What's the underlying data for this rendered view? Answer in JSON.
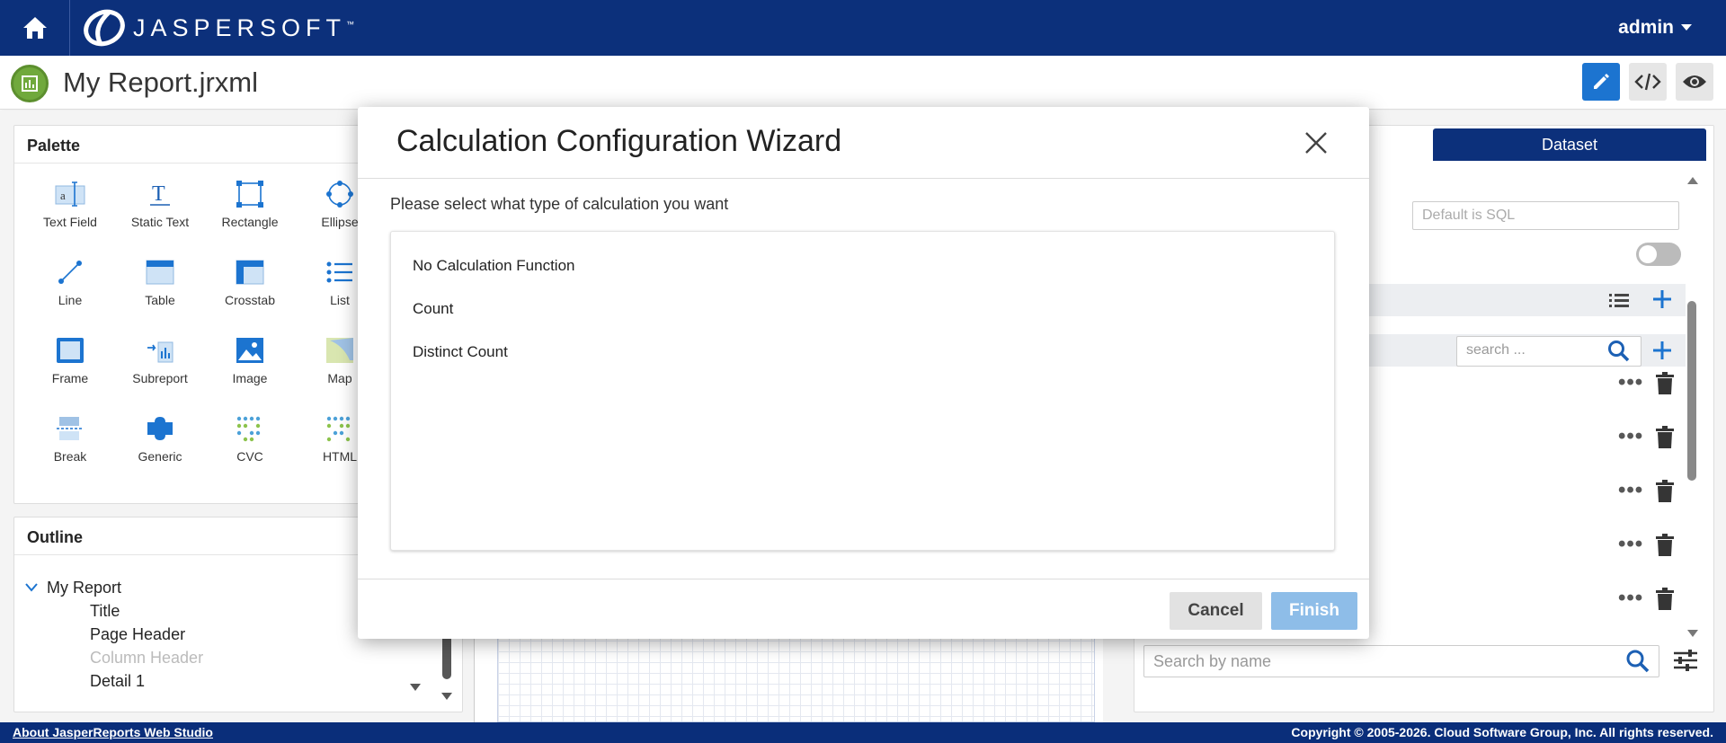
{
  "app": {
    "logo_text": "JASPERSOFT",
    "logo_tm": "™",
    "user": "admin",
    "report_title": "My Report.jrxml"
  },
  "palette": {
    "title": "Palette",
    "items": [
      {
        "label": "Text Field"
      },
      {
        "label": "Static Text"
      },
      {
        "label": "Rectangle"
      },
      {
        "label": "Ellipse"
      },
      {
        "label": "Line"
      },
      {
        "label": "Table"
      },
      {
        "label": "Crosstab"
      },
      {
        "label": "List"
      },
      {
        "label": "Frame"
      },
      {
        "label": "Subreport"
      },
      {
        "label": "Image"
      },
      {
        "label": "Map"
      },
      {
        "label": "Break"
      },
      {
        "label": "Generic"
      },
      {
        "label": "CVC"
      },
      {
        "label": "HTML"
      }
    ]
  },
  "outline": {
    "title": "Outline",
    "root": "My Report",
    "children": [
      "Title",
      "Page Header",
      "Column Header",
      "Detail 1"
    ]
  },
  "right_panel": {
    "tab": "Dataset",
    "query_language_placeholder": "Default is SQL",
    "search_placeholder": "search ...",
    "search_by_name_placeholder": "Search by name"
  },
  "modal": {
    "title": "Calculation Configuration Wizard",
    "prompt": "Please select what type of calculation you want",
    "options": [
      "No Calculation Function",
      "Count",
      "Distinct Count"
    ],
    "cancel_label": "Cancel",
    "finish_label": "Finish"
  },
  "footer": {
    "link": "About JasperReports Web Studio",
    "copyright": "Copyright © 2005-2026. Cloud Software Group, Inc. All rights reserved."
  },
  "colors": {
    "brand_navy": "#0a2e7a",
    "accent_blue": "#1a73d0",
    "finish_disabled": "#8ebde8"
  }
}
